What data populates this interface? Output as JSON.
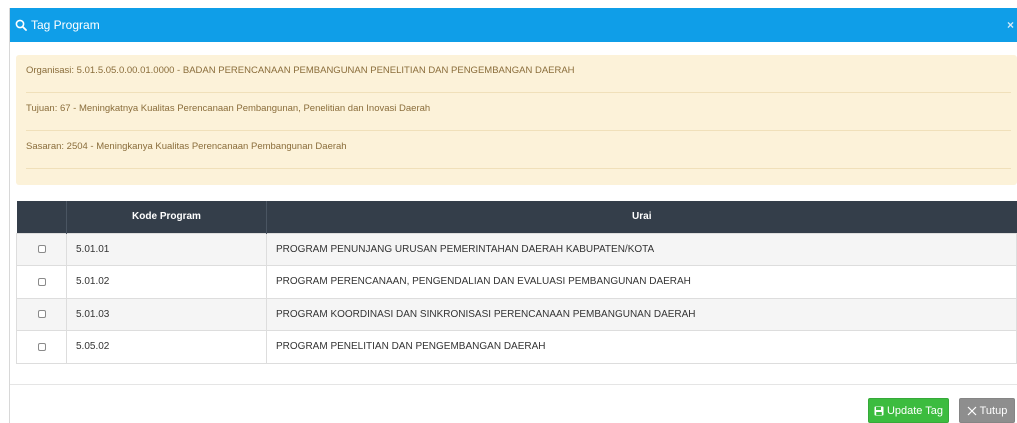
{
  "modal": {
    "title": "Tag Program",
    "close_glyph": "×",
    "title_icon": "search-icon",
    "header_color": "#0f9ee8"
  },
  "info": {
    "organisasi": "Organisasi: 5.01.5.05.0.00.01.0000 - BADAN PERENCANAAN PEMBANGUNAN PENELITIAN DAN PENGEMBANGAN DAERAH",
    "tujuan": "Tujuan: 67 - Meningkatnya Kualitas Perencanaan Pembangunan, Penelitian dan Inovasi Daerah",
    "sasaran": "Sasaran: 2504 - Meningkanya Kualitas Perencanaan Pembangunan Daerah",
    "background_color": "#fcf2d9"
  },
  "table": {
    "headers": [
      "",
      "Kode Program",
      "Urai"
    ],
    "rows": [
      {
        "code": "5.01.01",
        "urai": "PROGRAM PENUNJANG URUSAN PEMERINTAHAN DAERAH KABUPATEN/KOTA",
        "checked": false
      },
      {
        "code": "5.01.02",
        "urai": "PROGRAM PERENCANAAN, PENGENDALIAN DAN EVALUASI PEMBANGUNAN DAERAH",
        "checked": false
      },
      {
        "code": "5.01.03",
        "urai": "PROGRAM KOORDINASI DAN SINKRONISASI PERENCANAAN PEMBANGUNAN DAERAH",
        "checked": false
      },
      {
        "code": "5.05.02",
        "urai": "PROGRAM PENELITIAN DAN PENGEMBANGAN DAERAH",
        "checked": false
      }
    ],
    "header_color": "#343e4a"
  },
  "footer": {
    "update_label": "Update Tag",
    "update_icon": "save-icon",
    "update_color": "#3cbc3f",
    "close_label": "Tutup",
    "close_icon": "close-icon",
    "close_color": "#8e8e8e"
  }
}
